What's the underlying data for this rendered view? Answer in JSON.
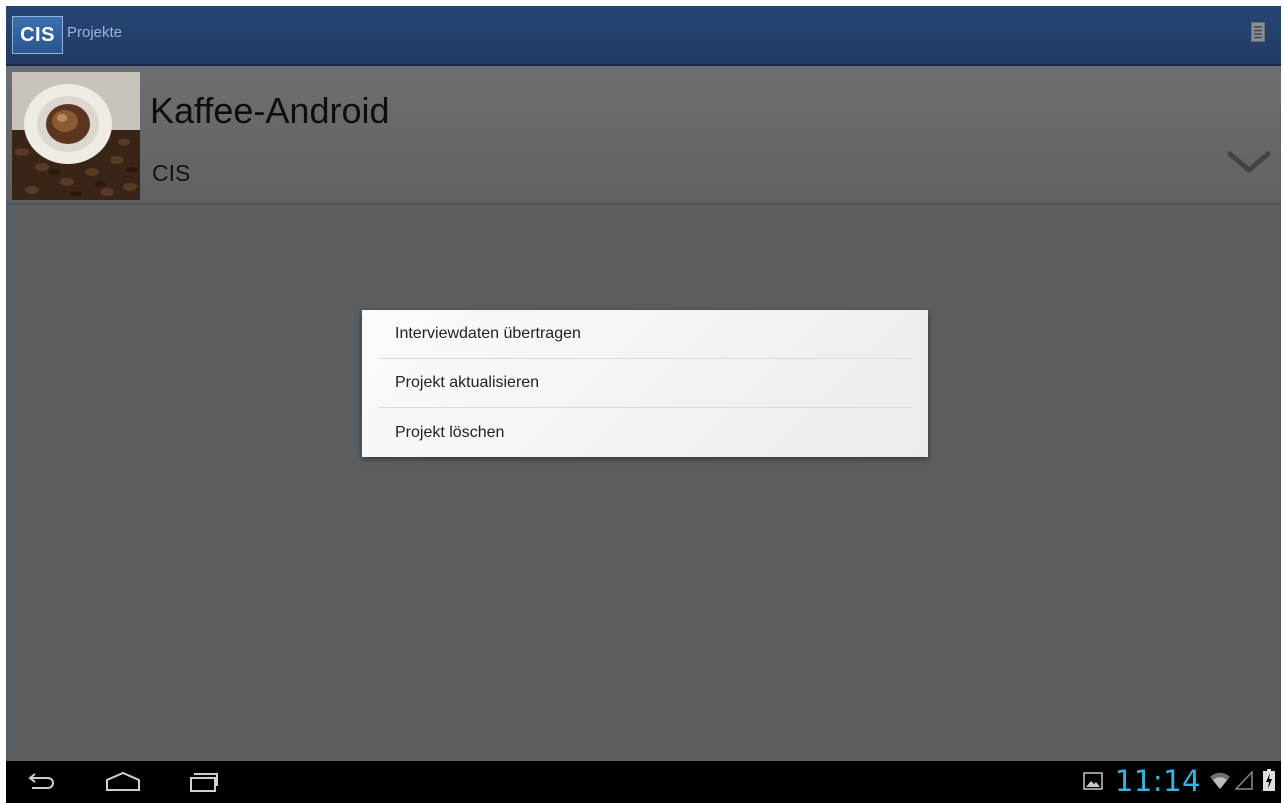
{
  "action_bar": {
    "logo_text": "CIS",
    "title": "Projekte",
    "menu_icon": "list-icon",
    "colors": {
      "background": "#223b64",
      "logo": "#2a5692"
    }
  },
  "project": {
    "name": "Kaffee-Android",
    "owner": "CIS",
    "thumbnail": "coffee-cup-image",
    "expand_icon": "chevron-down-icon"
  },
  "context_menu": {
    "items": [
      {
        "label": "Interviewdaten übertragen"
      },
      {
        "label": "Projekt aktualisieren"
      },
      {
        "label": "Projekt löschen"
      }
    ]
  },
  "navigation_bar": {
    "buttons": [
      "back-icon",
      "home-icon",
      "recent-apps-icon"
    ]
  },
  "status_bar": {
    "time": "11:14",
    "icons": [
      "gallery-notification-icon",
      "wifi-icon",
      "signal-icon",
      "battery-charging-icon"
    ],
    "colors": {
      "clock": "#33b5e5"
    }
  }
}
